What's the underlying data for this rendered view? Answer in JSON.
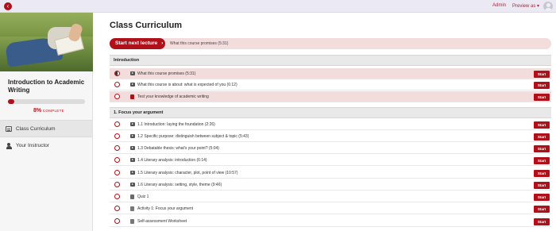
{
  "topbar": {
    "admin_label": "Admin",
    "preview_label": "Preview as ▾"
  },
  "course": {
    "title": "Introduction to Academic Writing",
    "progress_percent": 8,
    "progress_pct_text": "8%",
    "progress_label": "COMPLETE"
  },
  "nav": {
    "items": [
      {
        "label": "Class Curriculum",
        "icon": "curriculum-icon",
        "active": true
      },
      {
        "label": "Your Instructor",
        "icon": "person-icon",
        "active": false
      }
    ]
  },
  "main": {
    "title": "Class Curriculum",
    "next_button_label": "Start next lecture",
    "next_lecture_title": "What this course promises (5:31)"
  },
  "sections": [
    {
      "title": "Introduction",
      "lectures": [
        {
          "title": "What this course promises (5:31)",
          "type": "video",
          "status": "in-progress",
          "highlight": true,
          "action": "Start"
        },
        {
          "title": "What this course is about: what is expected of you (6:12)",
          "type": "video",
          "status": "not-started",
          "highlight": false,
          "action": "Start"
        },
        {
          "title": "Test your knowledge of academic writing",
          "type": "document",
          "status": "not-started",
          "highlight": true,
          "action": "Start"
        }
      ]
    },
    {
      "title": "1. Focus your argument",
      "lectures": [
        {
          "title": "1.1 Introduction: laying the foundation (2:26)",
          "type": "video",
          "status": "not-started",
          "action": "Start"
        },
        {
          "title": "1.2 Specific purpose: distinguish between subject & topic (5:43)",
          "type": "video",
          "status": "not-started",
          "action": "Start"
        },
        {
          "title": "1.3 Debatable thesis: what's your point? (5:04)",
          "type": "video",
          "status": "not-started",
          "action": "Start"
        },
        {
          "title": "1.4 Literary analysis: introduction (6:14)",
          "type": "video",
          "status": "not-started",
          "action": "Start"
        },
        {
          "title": "1.5 Literary analysis: character, plot, point of view (10:57)",
          "type": "video",
          "status": "not-started",
          "action": "Start"
        },
        {
          "title": "1.6 Literary analysis: setting, style, theme (9:46)",
          "type": "video",
          "status": "not-started",
          "action": "Start"
        },
        {
          "title": "Quiz 1",
          "type": "quiz",
          "status": "not-started",
          "action": "Start"
        },
        {
          "title": "Activity 1: Focus your argument",
          "type": "document",
          "status": "not-started",
          "action": "Start"
        },
        {
          "title": "Self-assessment Worksheet",
          "type": "document",
          "status": "not-started",
          "action": "Start"
        }
      ]
    }
  ],
  "colors": {
    "accent": "#b0101a",
    "highlight_row": "#f3dcdc",
    "section_header": "#e9e9e9"
  }
}
